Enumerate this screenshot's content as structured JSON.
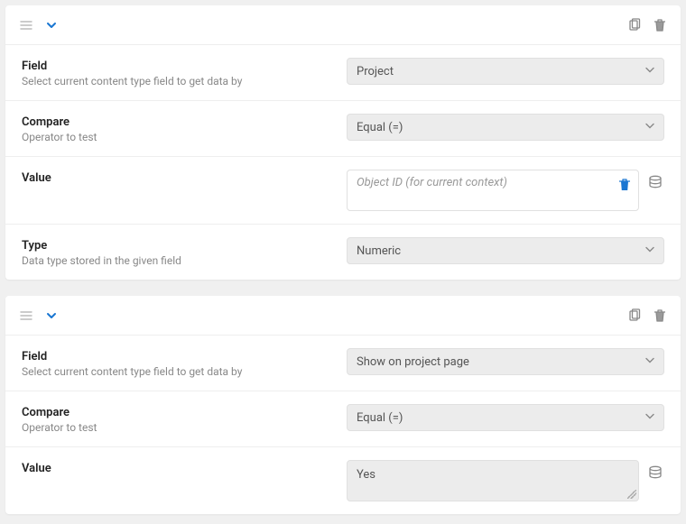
{
  "cards": [
    {
      "field": {
        "title": "Field",
        "subtitle": "Select current content type field to get data by",
        "value": "Project"
      },
      "compare": {
        "title": "Compare",
        "subtitle": "Operator to test",
        "value": "Equal (=)"
      },
      "value": {
        "title": "Value",
        "placeholder": "Object ID (for current context)"
      },
      "type": {
        "title": "Type",
        "subtitle": "Data type stored in the given field",
        "value": "Numeric"
      }
    },
    {
      "field": {
        "title": "Field",
        "subtitle": "Select current content type field to get data by",
        "value": "Show on project page"
      },
      "compare": {
        "title": "Compare",
        "subtitle": "Operator to test",
        "value": "Equal (=)"
      },
      "value": {
        "title": "Value",
        "text": "Yes"
      }
    }
  ]
}
